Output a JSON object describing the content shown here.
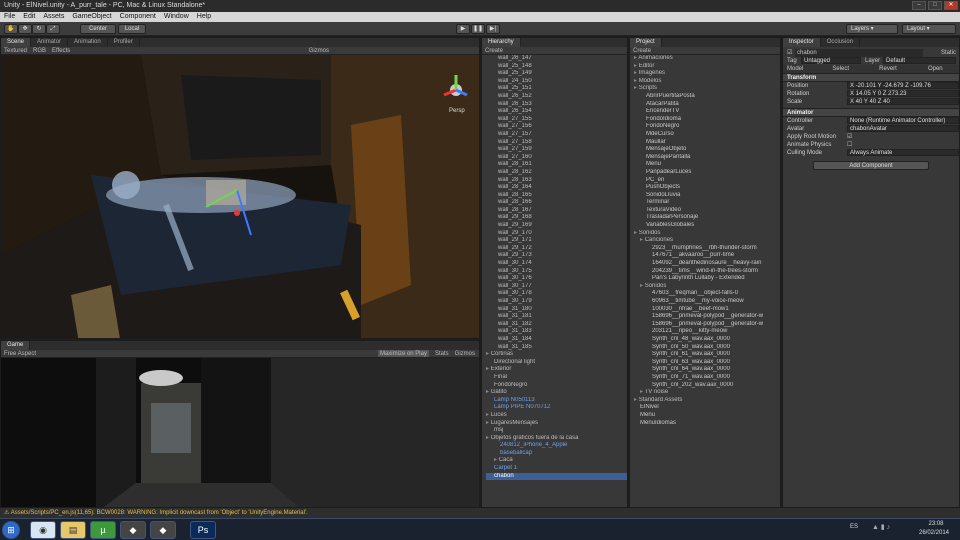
{
  "window": {
    "title": "Unity - ElNivel.unity - A_purr_tale - PC, Mac & Linux Standalone*"
  },
  "menu": [
    "File",
    "Edit",
    "Assets",
    "GameObject",
    "Component",
    "Window",
    "Help"
  ],
  "toolbar": {
    "center": "Center",
    "local": "Local",
    "layers": "Layers",
    "layout": "Layout"
  },
  "scene": {
    "tabs": [
      "Scene",
      "Animator",
      "Animation",
      "Profiler"
    ],
    "mode": "Textured",
    "rgb": "RGB",
    "effects": "Effects",
    "gizmos": "Gizmos",
    "persp": "Persp"
  },
  "game": {
    "tab": "Game",
    "aspect": "Free Aspect",
    "maximize": "Maximize on Play",
    "stats": "Stats",
    "gizmos": "Gizmos"
  },
  "hierarchy": {
    "tab": "Hierarchy",
    "create": "Create",
    "walls": [
      "wall_26_147",
      "wall_25_148",
      "wall_25_149",
      "wall_24_150",
      "wall_25_151",
      "wall_26_152",
      "wall_26_153",
      "wall_26_154",
      "wall_27_155",
      "wall_27_156",
      "wall_27_157",
      "wall_27_158",
      "wall_27_159",
      "wall_27_160",
      "wall_28_161",
      "wall_28_162",
      "wall_28_163",
      "wall_28_164",
      "wall_28_165",
      "wall_28_166",
      "wall_28_167",
      "wall_29_168",
      "wall_29_169",
      "wall_29_170",
      "wall_29_171",
      "wall_29_172",
      "wall_29_173",
      "wall_30_174",
      "wall_30_175",
      "wall_30_176",
      "wall_30_177",
      "wall_30_178",
      "wall_30_179",
      "wall_31_180",
      "wall_31_181",
      "wall_31_182",
      "wall_31_183",
      "wall_31_184",
      "wall_31_185"
    ],
    "items": [
      "Cortinas",
      "Directional light",
      "Exterior",
      "Final",
      "FondoNegro",
      "Gatito",
      "Lamp N050113",
      "Lamp PIPE N070712",
      "Luces",
      "LugaresMensajes",
      "msj",
      "Objetos graficos fuera de la casa",
      "240812_iPhone_4_Apple",
      "baseballcap",
      "Caca",
      "Carpet 1",
      "chabon"
    ]
  },
  "project": {
    "tab": "Project",
    "create": "Create",
    "folders_top": [
      "Animaciones",
      "Editor",
      "Imagenes",
      "Modelos",
      "Scripts"
    ],
    "scripts": [
      "AbrirPuertitaPosta",
      "AtacarPatita",
      "EncenderTV",
      "FondoIdioma",
      "FondoNegro",
      "MdeCurso",
      "Maullar",
      "MensajeObjeto",
      "MensajePantalla",
      "Menu",
      "PanpadearLuces",
      "PC_en",
      "PushObjects",
      "SonidoLluvia",
      "Terminar",
      "TexturaVideo",
      "TrasladarPersonaje",
      "VariablesGlobales"
    ],
    "sonidos": "Sonidos",
    "canciones_label": "Canciones",
    "canciones": [
      "2923__rhumphries__rbh-thunder-storm",
      "147671__akvaaroo__purr-time",
      "164092__deanthedinosaure__heavy-rain",
      "204239__tims__wind-in-the-trees-storm",
      "Pan's Labyrinth Lullaby - Extended"
    ],
    "sonidos_label": "Sonidos",
    "sonidos_files": [
      "47603__freqman__object-falls-0",
      "60963__timtube__my-voice-meow",
      "100030__nfrae__beef-mow1",
      "158696__primeval-polypod__generator-w",
      "158696__primeval-polypod__generator-w",
      "203121__npeo__kitty-meow",
      "Synth_cnl_48_wav.aax_0000",
      "Synth_cnl_50_wav.aax_0000",
      "Synth_cnl_61_wav.aax_0000",
      "Synth_cnl_63_wav.aax_0000",
      "Synth_cnl_64_wav.aax_0000",
      "Synth_cnl_71_wav.aax_0000",
      "Synth_cnl_202_wav.aax_0000"
    ],
    "bottom": [
      "TV noise",
      "Standard Assets",
      "ElNivel",
      "Menu",
      "MenuIdiomas"
    ]
  },
  "inspector": {
    "tabs": [
      "Inspector",
      "Occlusion"
    ],
    "object": "chabon",
    "static": "Static",
    "tag_label": "Tag",
    "tag": "Untagged",
    "layer_label": "Layer",
    "layer": "Default",
    "model_label": "Model",
    "select": "Select",
    "revert": "Revert",
    "open": "Open",
    "transform": "Transform",
    "position": "Position",
    "pos": "X -20.101  Y -24.679  Z -109.76",
    "rotation": "Rotation",
    "rot": "X 14.05   Y 0   Z 273.23",
    "scale": "Scale",
    "scl": "X 40   Y 40   Z 40",
    "animator": "Animator",
    "controller_label": "Controller",
    "controller": "None (Runtime Animator Controller)",
    "avatar_label": "Avatar",
    "avatar": "chabonAvatar",
    "root_motion": "Apply Root Motion",
    "physics": "Animate Physics",
    "culling_label": "Culling Mode",
    "culling": "Always Animate",
    "add_component": "Add Component"
  },
  "status": "Assets/Scripts/PC_en.js(11,65): BCW0028: WARNING: Implicit downcast from 'Object' to 'UnityEngine.Material'.",
  "taskbar": {
    "lang": "ES",
    "time": "23:08",
    "date": "26/02/2014"
  }
}
